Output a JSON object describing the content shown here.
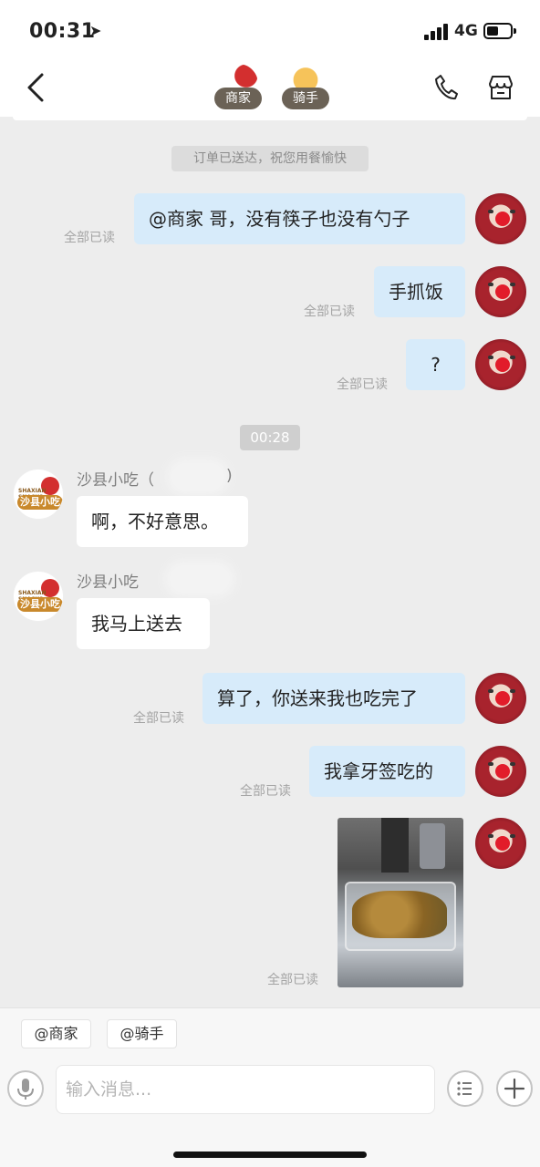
{
  "status_bar": {
    "time": "00:31",
    "network": "4G"
  },
  "header": {
    "merchant_label": "商家",
    "rider_label": "骑手"
  },
  "chat": {
    "system_notice": "订单已送达，祝您用餐愉快",
    "time_divider": "00:28",
    "messages": [
      {
        "side": "out",
        "text": "@商家 哥，没有筷子也没有勺子",
        "read": "全部已读"
      },
      {
        "side": "out",
        "text": "手抓饭",
        "read": "全部已读"
      },
      {
        "side": "out",
        "text": "?",
        "read": "全部已读"
      },
      {
        "side": "in",
        "sender": "沙县小吃（",
        "sender_suffix": ")",
        "text": "啊，不好意思。"
      },
      {
        "side": "in",
        "sender": "沙县小吃",
        "text": "我马上送去"
      },
      {
        "side": "out",
        "text": "算了，你送来我也吃完了",
        "read": "全部已读"
      },
      {
        "side": "out",
        "text": "我拿牙签吃的",
        "read": "全部已读"
      },
      {
        "side": "out",
        "type": "image",
        "read": "全部已读"
      }
    ],
    "shop_avatar_text": "沙县小吃",
    "shop_avatar_brand": "SHAXIAN SNACKS"
  },
  "composer": {
    "at_merchant": "@商家",
    "at_rider": "@骑手",
    "placeholder": "输入消息..."
  },
  "icons": {
    "back": "chevron-left-icon",
    "phone": "phone-icon",
    "store": "store-icon",
    "mic": "microphone-icon",
    "list": "list-icon",
    "plus": "plus-icon"
  }
}
